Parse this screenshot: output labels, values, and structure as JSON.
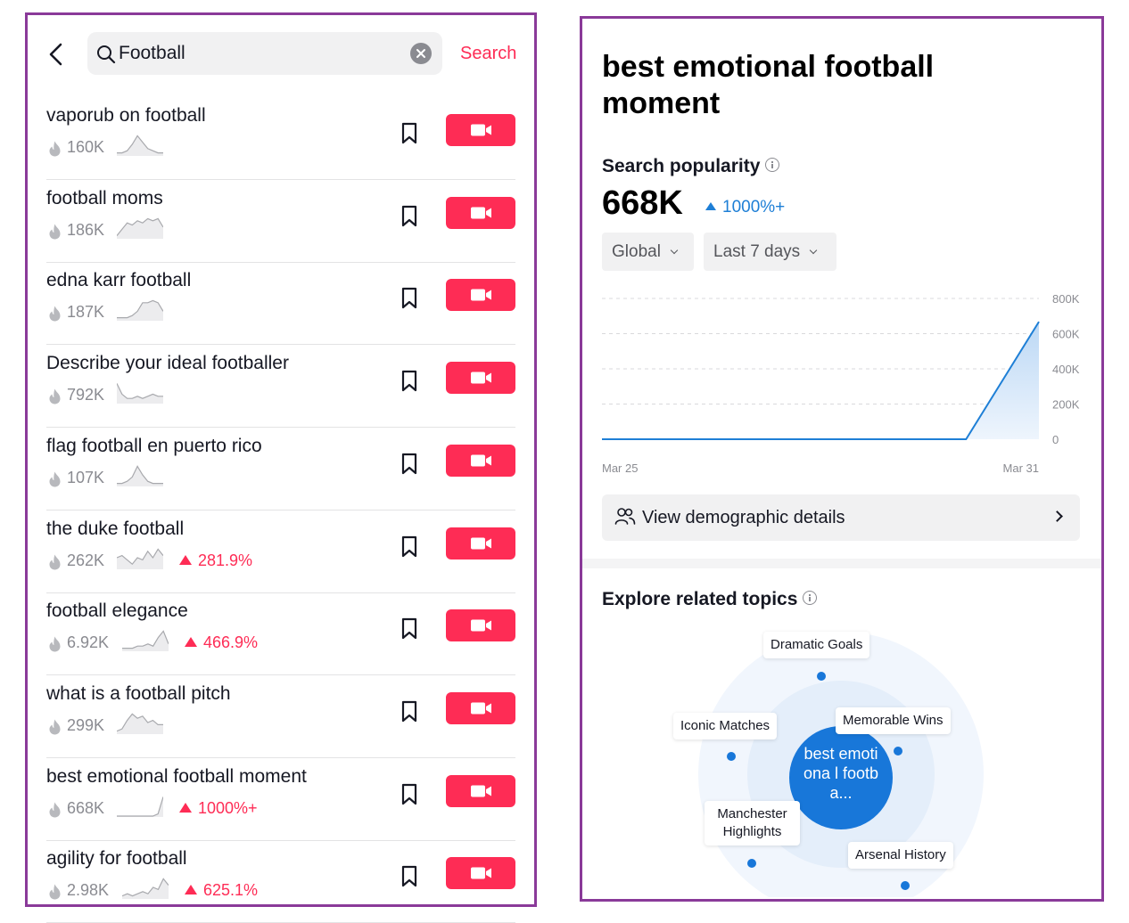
{
  "search": {
    "query": "Football",
    "action_label": "Search"
  },
  "results": [
    {
      "title": "vaporub on football",
      "count": "160K",
      "trend": "",
      "spark": [
        1,
        1,
        2,
        5,
        9,
        6,
        3,
        2,
        1,
        1
      ]
    },
    {
      "title": "football moms",
      "count": "186K",
      "trend": "",
      "spark": [
        1,
        4,
        7,
        6,
        8,
        7,
        9,
        8,
        9,
        5
      ]
    },
    {
      "title": "edna karr football",
      "count": "187K",
      "trend": "",
      "spark": [
        1,
        1,
        1,
        2,
        4,
        8,
        8,
        9,
        8,
        4
      ]
    },
    {
      "title": "Describe your ideal footballer",
      "count": "792K",
      "trend": "",
      "spark": [
        9,
        4,
        2,
        2,
        3,
        2,
        3,
        4,
        3,
        3
      ]
    },
    {
      "title": "flag football en puerto rico",
      "count": "107K",
      "trend": "",
      "spark": [
        1,
        1,
        2,
        4,
        9,
        5,
        2,
        1,
        1,
        1
      ]
    },
    {
      "title": "the duke football",
      "count": "262K",
      "trend": "281.9%",
      "spark": [
        5,
        6,
        4,
        2,
        5,
        4,
        8,
        5,
        9,
        6
      ]
    },
    {
      "title": "football elegance",
      "count": "6.92K",
      "trend": "466.9%",
      "spark": [
        1,
        1,
        1,
        2,
        2,
        3,
        2,
        6,
        9,
        3
      ]
    },
    {
      "title": "what is a football pitch",
      "count": "299K",
      "trend": "",
      "spark": [
        1,
        2,
        6,
        9,
        7,
        8,
        5,
        6,
        4,
        4
      ]
    },
    {
      "title": "best emotional football moment",
      "count": "668K",
      "trend": "1000%+",
      "spark": [
        0,
        0,
        0,
        0,
        0,
        0,
        0,
        0,
        1,
        9
      ]
    },
    {
      "title": "agility for football",
      "count": "2.98K",
      "trend": "625.1%",
      "spark": [
        1,
        2,
        1,
        2,
        3,
        2,
        5,
        4,
        9,
        6
      ]
    }
  ],
  "detail": {
    "title": "best emotional football moment",
    "popularity_label": "Search popularity",
    "popularity_value": "668K",
    "popularity_change": "1000%+",
    "region_filter": "Global",
    "period_filter": "Last 7 days",
    "demographic_label": "View demographic details",
    "explore_label": "Explore related topics",
    "related_center": "best emotiona l footba...",
    "related_topics": [
      "Dramatic Goals",
      "Iconic Matches",
      "Memorable Wins",
      "Manchester Highlights",
      "Arsenal History"
    ]
  },
  "colors": {
    "accent_red": "#fe2c55",
    "accent_blue": "#1e7fd6",
    "frame_purple": "#8a3a99"
  },
  "chart_data": {
    "type": "area",
    "title": "",
    "xlabel": "",
    "ylabel": "",
    "x": [
      "Mar 25",
      "Mar 26",
      "Mar 27",
      "Mar 28",
      "Mar 29",
      "Mar 30",
      "Mar 31"
    ],
    "x_tick_labels": [
      "Mar 25",
      "Mar 31"
    ],
    "series": [
      {
        "values": [
          0,
          0,
          0,
          0,
          0,
          0,
          668000
        ]
      }
    ],
    "y_ticks": [
      "0",
      "200K",
      "400K",
      "600K",
      "800K"
    ],
    "ylim": [
      0,
      800000
    ],
    "grid": true,
    "line_color": "#1e7fd6"
  }
}
